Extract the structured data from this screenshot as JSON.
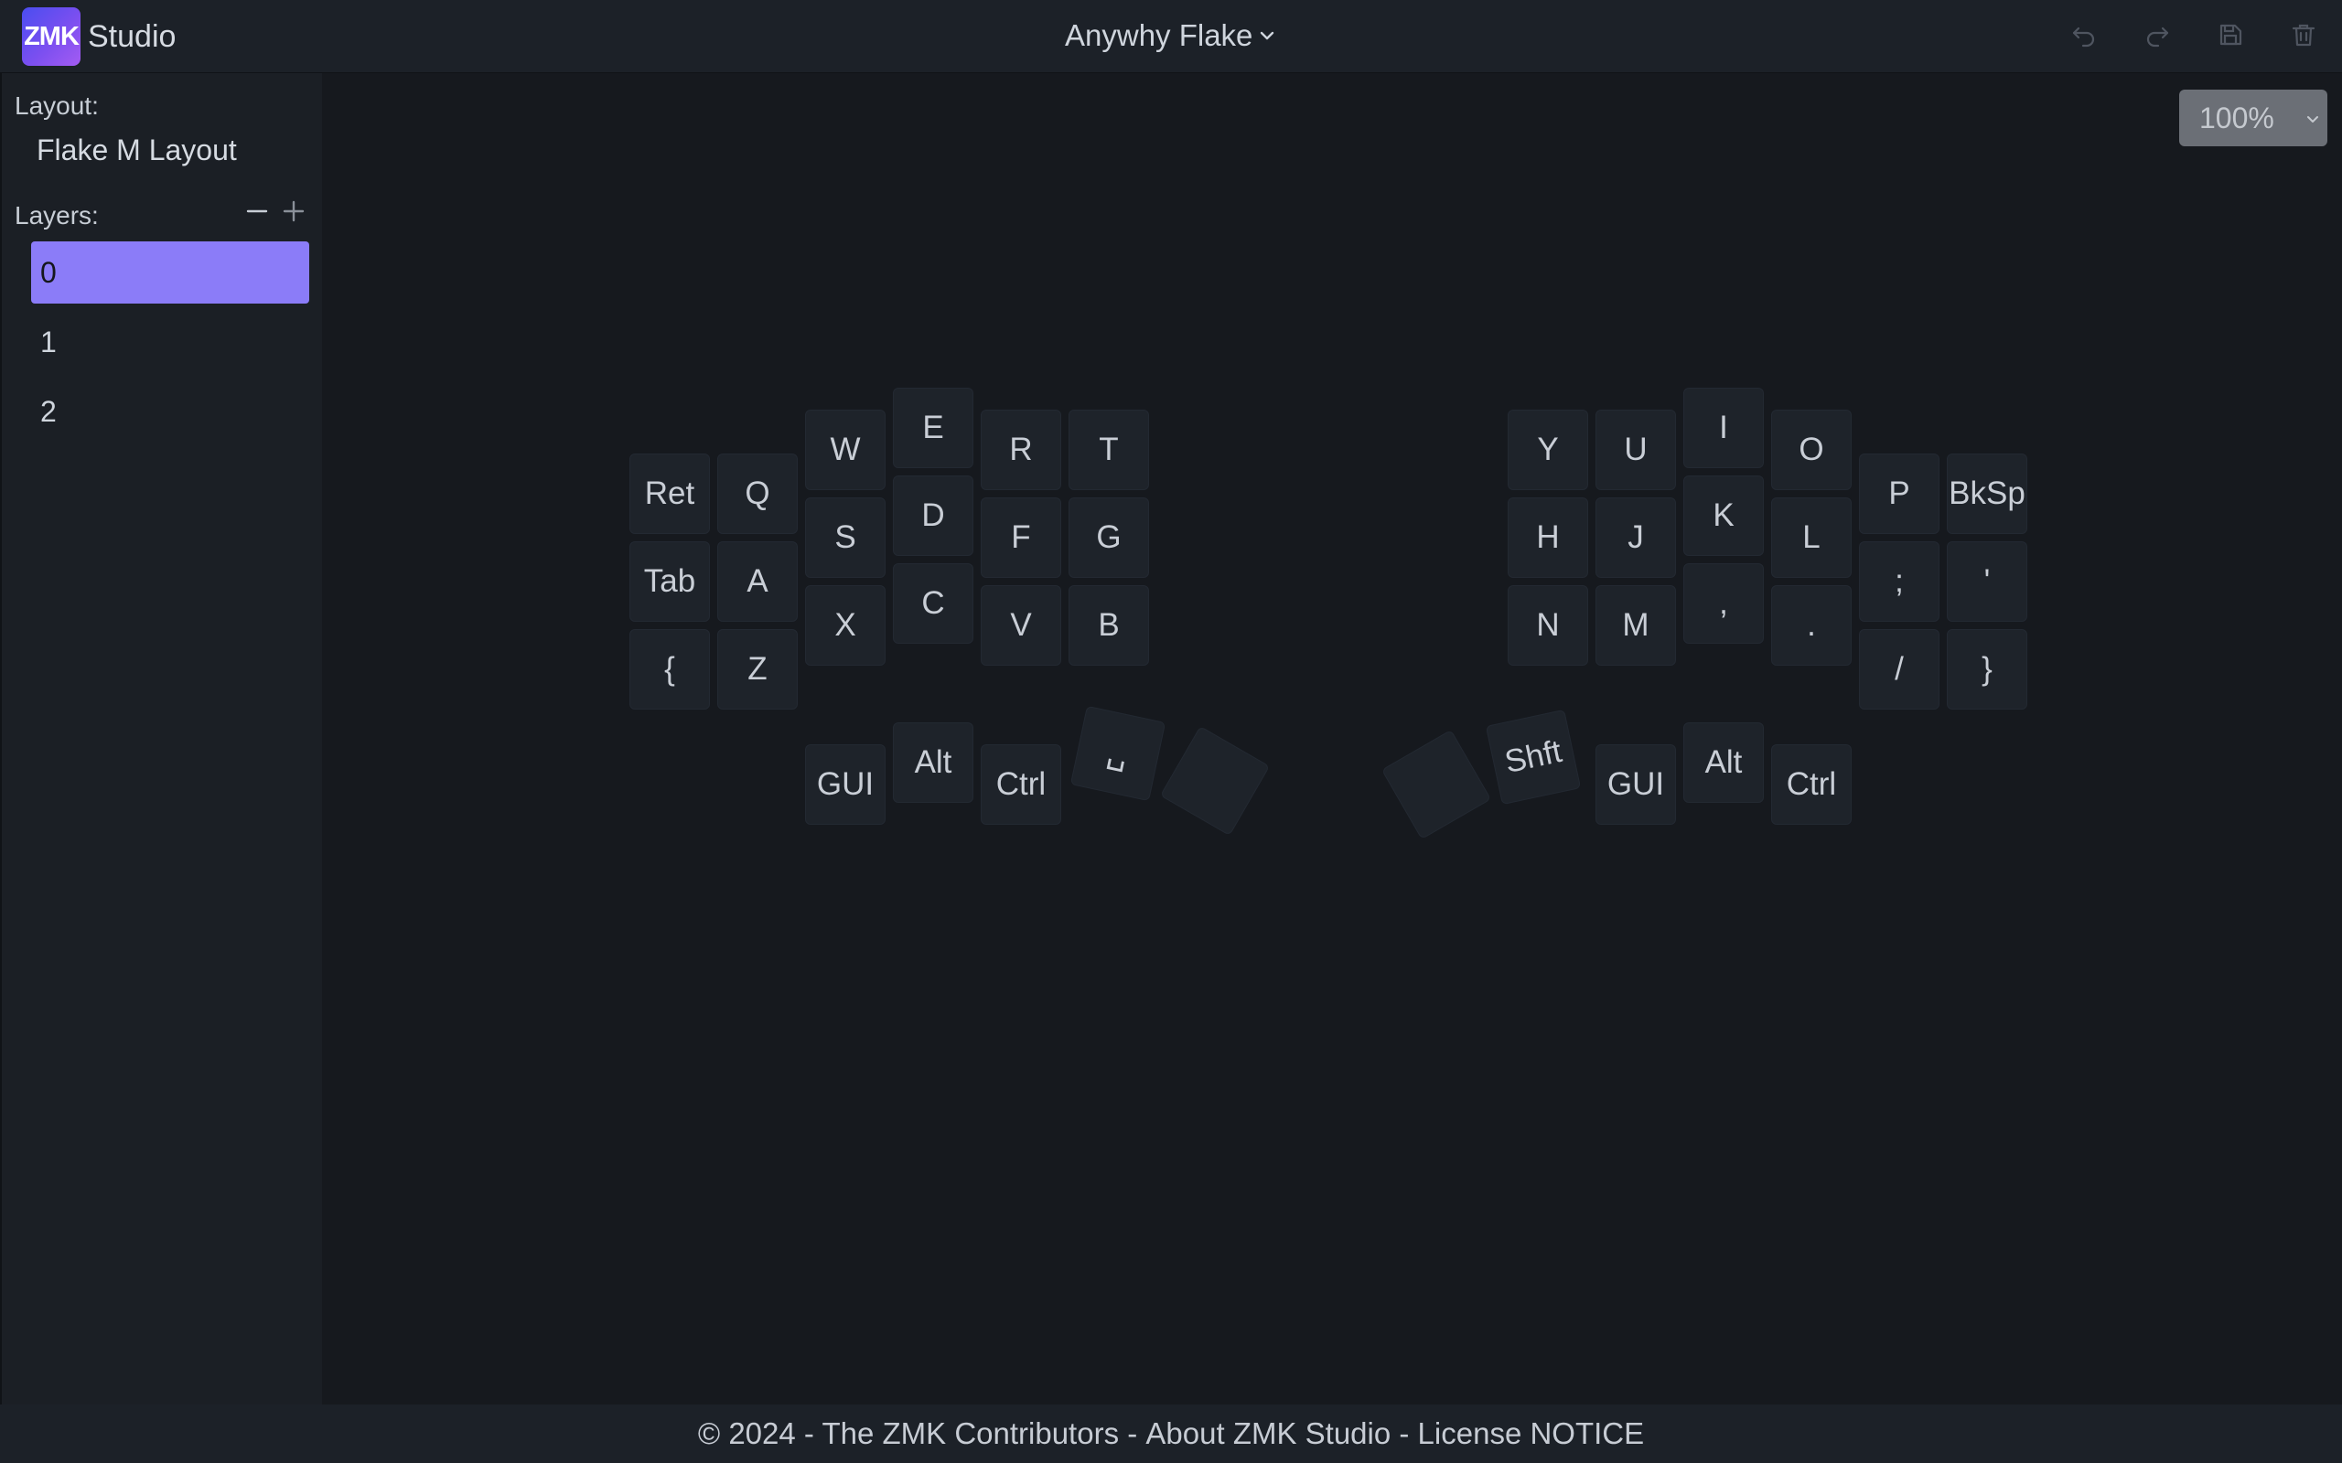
{
  "header": {
    "logo_text": "ZMK",
    "app_name": "Studio",
    "keyboard_name": "Anywhy Flake",
    "actions": [
      "undo-icon",
      "redo-icon",
      "save-icon",
      "trash-icon"
    ]
  },
  "sidebar": {
    "layout_label": "Layout:",
    "layout_name": "Flake M Layout",
    "layers_label": "Layers:",
    "layers": [
      {
        "label": "0",
        "selected": true
      },
      {
        "label": "1",
        "selected": false
      },
      {
        "label": "2",
        "selected": false
      }
    ]
  },
  "zoom": {
    "value": "100%"
  },
  "keymap": {
    "keys": [
      "Ret",
      "Q",
      "W",
      "E",
      "R",
      "T",
      "Tab",
      "A",
      "S",
      "D",
      "F",
      "G",
      "{",
      "Z",
      "X",
      "C",
      "V",
      "B",
      "GUI",
      "Alt",
      "Ctrl",
      "␣",
      "",
      "",
      "Shft",
      "GUI",
      "Alt",
      "Ctrl",
      "Y",
      "U",
      "I",
      "O",
      "P",
      "BkSp",
      "H",
      "J",
      "K",
      "L",
      ";",
      "'",
      "N",
      "M",
      ",",
      ".",
      "/",
      "}"
    ]
  },
  "footer": {
    "copyright": "© 2024 - The ZMK Contributors",
    "separator": " - ",
    "about": "About ZMK Studio",
    "license": "License NOTICE"
  },
  "colors": {
    "accent": "#8b7cf8",
    "background": "#16191e",
    "sidebar": "#1b1f25",
    "key": "#1e232a"
  }
}
